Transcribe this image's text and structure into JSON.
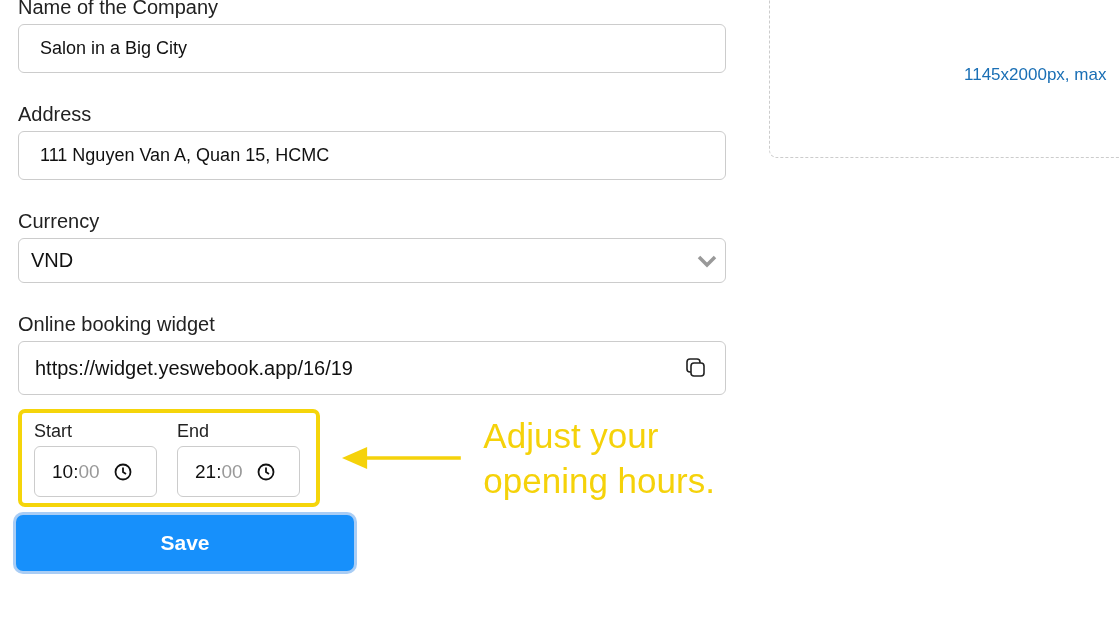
{
  "fields": [
    {
      "kind": "text",
      "label": "Name of the Company",
      "value": "Salon in a Big City"
    },
    {
      "kind": "text",
      "label": "Address",
      "value": "111 Nguyen Van A, Quan 15, HCMC"
    },
    {
      "kind": "select",
      "label": "Currency",
      "value": "VND"
    },
    {
      "kind": "copy",
      "label": "Online booking widget",
      "value": "https://widget.yeswebook.app/16/19"
    }
  ],
  "hours": [
    {
      "label": "Start",
      "hour": "10:",
      "minute": "00"
    },
    {
      "label": "End",
      "hour": "21:",
      "minute": "00"
    }
  ],
  "annotation": "Adjust your opening hours.",
  "save_button": "Save",
  "upload": {
    "hint": "1145x2000px, max"
  }
}
